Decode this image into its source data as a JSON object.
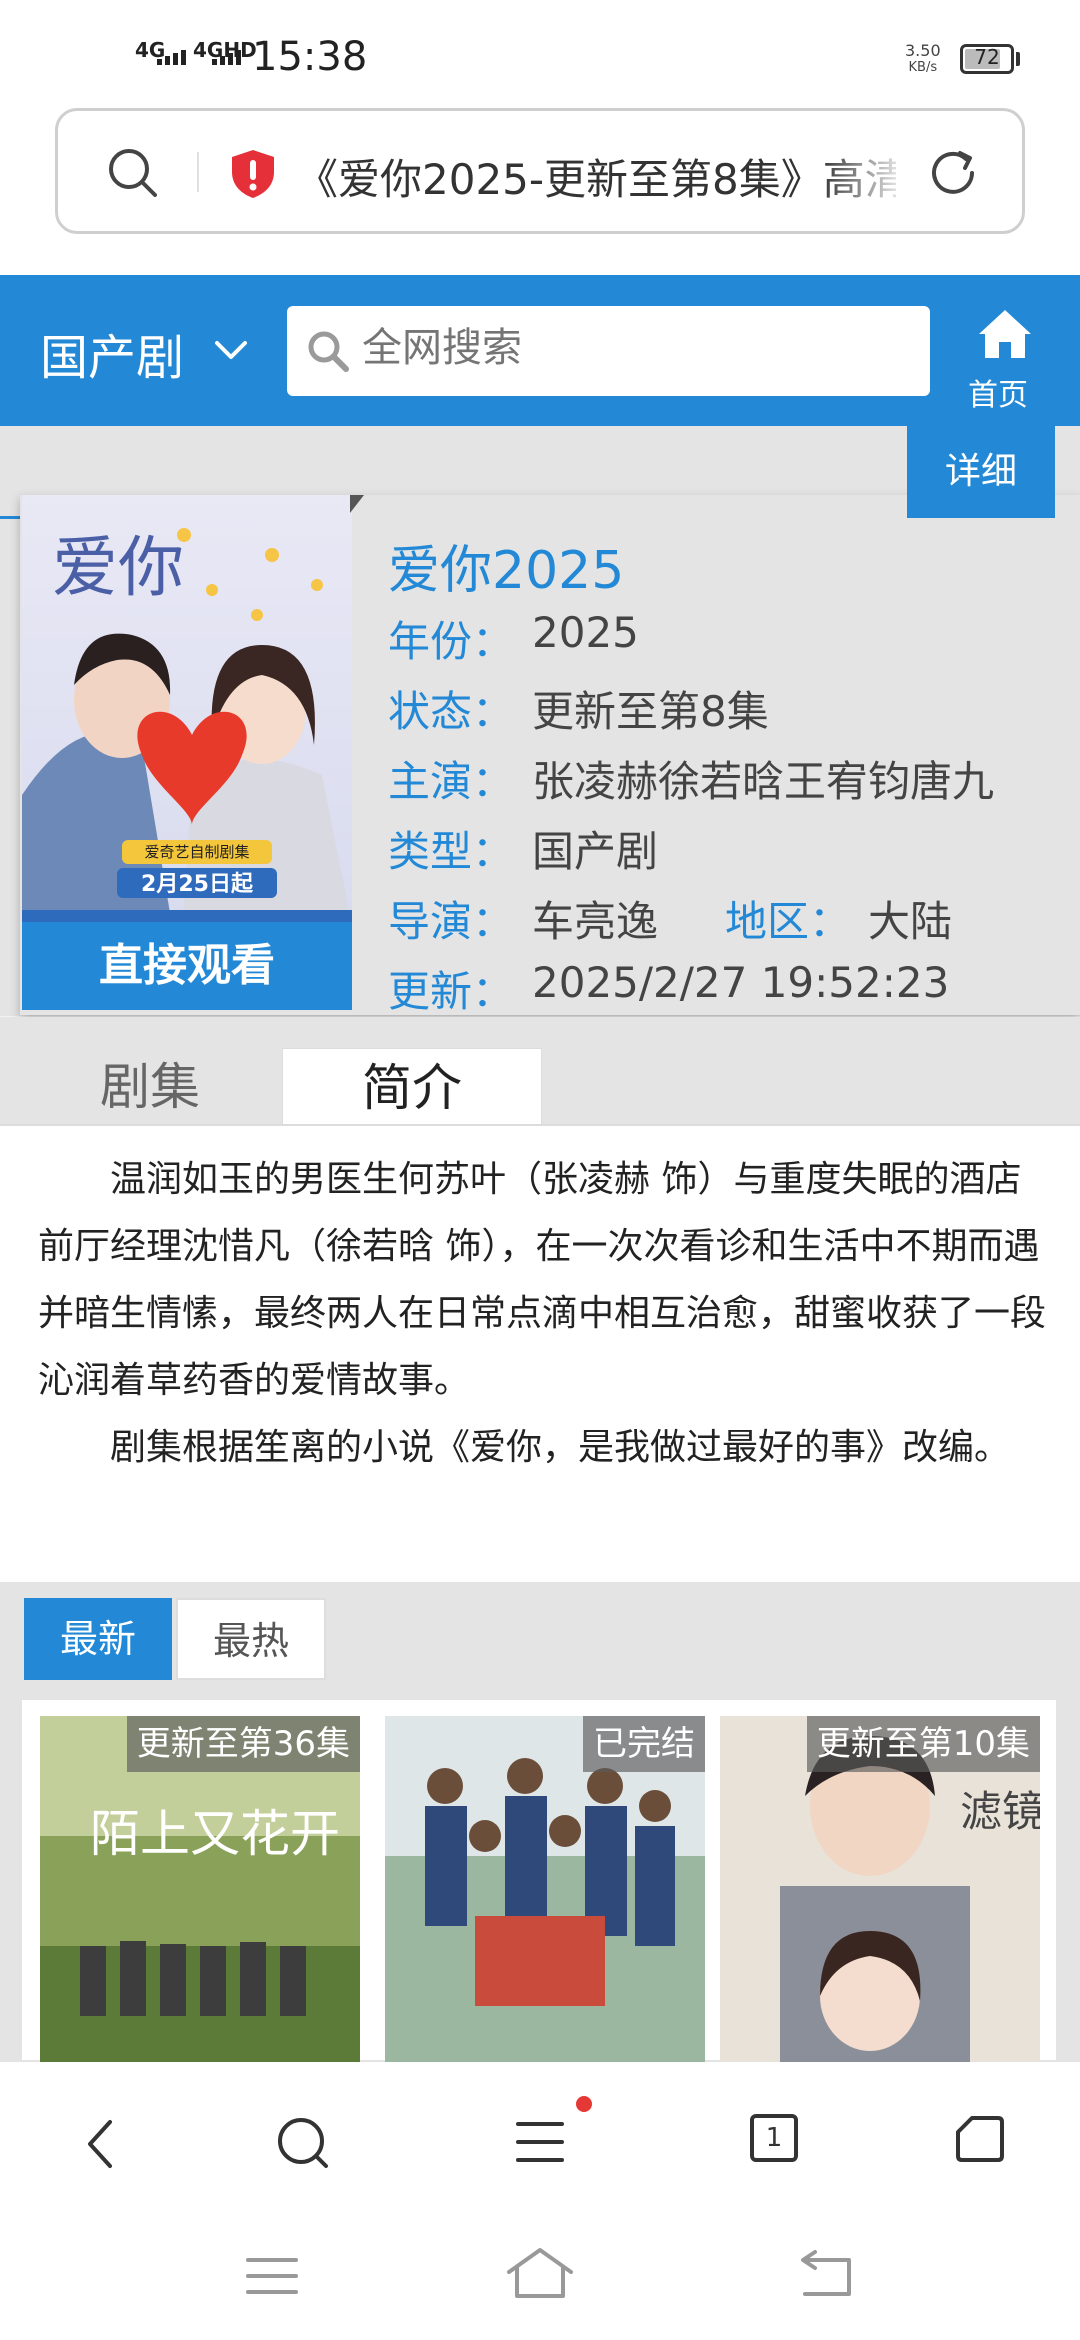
{
  "status_bar": {
    "sim1": "4G",
    "sim2": "4GHD",
    "time": "15:38",
    "net_speed_value": "3.50",
    "net_speed_unit": "KB/s",
    "battery": "72"
  },
  "browser": {
    "url_text": "《爱你2025-更新至第8集》高清"
  },
  "header": {
    "category": "国产剧",
    "search_placeholder": "全网搜索",
    "home_label": "首页"
  },
  "detail": {
    "tab_label": "详细",
    "title": "爱你2025",
    "year_label": "年份：",
    "year": "2025",
    "status_label": "状态：",
    "status": "更新至第8集",
    "cast_label": "主演：",
    "cast": "张凌赫徐若晗王宥钧唐九",
    "genre_label": "类型：",
    "genre": "国产剧",
    "director_label": "导演：",
    "director": "车亮逸",
    "region_label": "地区：",
    "region": "大陆",
    "updated_label": "更新：",
    "updated": "2025/2/27 19:52:23",
    "watch_button": "直接观看",
    "poster": {
      "title_art": "爱你",
      "badge": "爱奇艺自制剧集",
      "date": "2月25日起"
    }
  },
  "tabs": {
    "episodes": "剧集",
    "intro": "简介"
  },
  "synopsis": {
    "p1": "温润如玉的男医生何苏叶（张凌赫 饰）与重度失眠的酒店前厅经理沈惜凡（徐若晗 饰），在一次次看诊和生活中不期而遇并暗生情愫，最终两人在日常点滴中相互治愈，甜蜜收获了一段沁润着草药香的爱情故事。",
    "p2": "剧集根据笙离的小说《爱你，是我做过最好的事》改编。"
  },
  "list": {
    "tab_latest": "最新",
    "tab_hot": "最热",
    "items": [
      {
        "badge": "更新至第36集",
        "title_art": "陌上又花开"
      },
      {
        "badge": "已完结"
      },
      {
        "badge": "更新至第10集",
        "title_art": "滤镜"
      }
    ]
  },
  "colors": {
    "accent": "#2389d6",
    "background": "#e4e4e4"
  },
  "icons": {
    "url_search": "search-icon",
    "security": "shield-alert-icon",
    "reload": "reload-icon",
    "home": "home-icon",
    "back": "back-icon",
    "menu": "menu-icon",
    "tabs": "tab-count-icon",
    "browser_home": "browser-home-icon"
  },
  "bottom_bar": {
    "tab_count": "1"
  }
}
